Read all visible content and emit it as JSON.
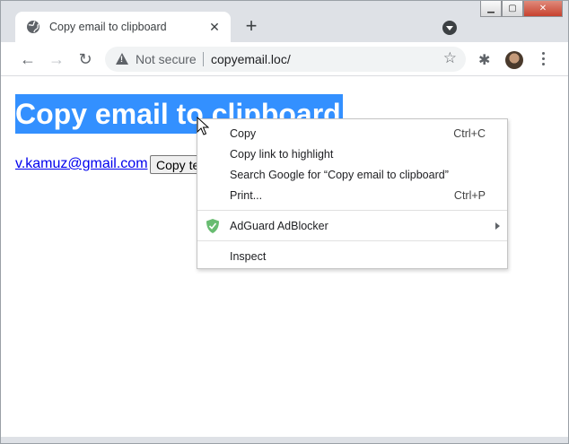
{
  "window": {
    "controls": {
      "minimize": "▁",
      "maximize": "▢",
      "close": "✕"
    }
  },
  "tab": {
    "title": "Copy email to clipboard",
    "icon": "globe-icon",
    "close": "✕",
    "new_tab": "+"
  },
  "toolbar": {
    "back": "←",
    "forward": "→",
    "reload": "↻",
    "security_label": "Not secure",
    "url": "copyemail.loc/",
    "bookmark": "☆",
    "extensions": "✱"
  },
  "page": {
    "heading": "Copy email to clipboard",
    "email": "v.kamuz@gmail.com",
    "copy_button": "Copy te"
  },
  "context_menu": {
    "items": [
      {
        "label": "Copy",
        "accelerator": "Ctrl+C"
      },
      {
        "label": "Copy link to highlight",
        "accelerator": ""
      },
      {
        "label": "Search Google for “Copy email to clipboard”",
        "accelerator": ""
      },
      {
        "label": "Print...",
        "accelerator": "Ctrl+P"
      },
      {
        "label": "AdGuard AdBlocker",
        "accelerator": "",
        "icon": "adguard-shield-icon",
        "submenu": true
      },
      {
        "label": "Inspect",
        "accelerator": ""
      }
    ]
  },
  "colors": {
    "selection": "#3390ff",
    "link": "#0000ee",
    "adguard": "#68bc71"
  }
}
